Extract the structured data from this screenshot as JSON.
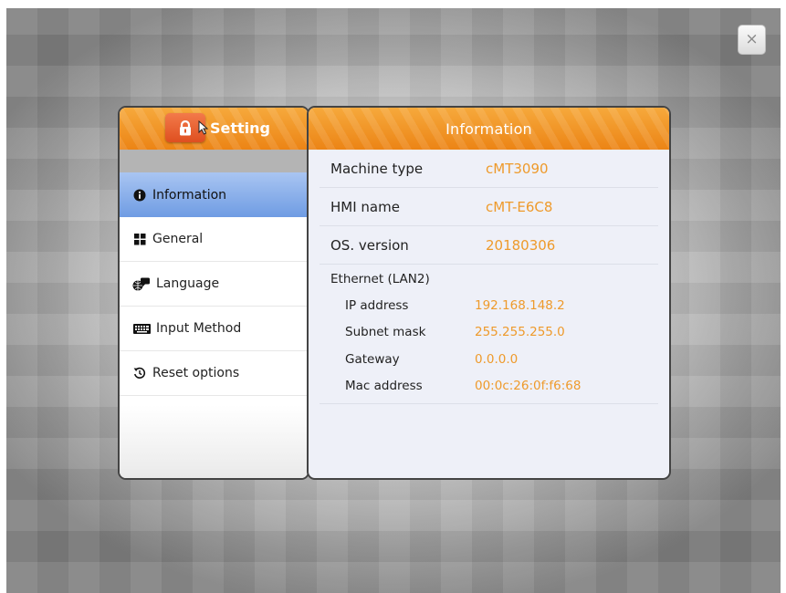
{
  "close_button": {
    "label": "×"
  },
  "left_panel": {
    "header_title": "Setting",
    "menu": [
      {
        "label": "Information",
        "icon": "info-circle-icon",
        "active": true
      },
      {
        "label": "General",
        "icon": "grid-icon",
        "active": false
      },
      {
        "label": "Language",
        "icon": "globe-chat-icon",
        "active": false
      },
      {
        "label": "Input Method",
        "icon": "keyboard-icon",
        "active": false
      },
      {
        "label": "Reset options",
        "icon": "reset-icon",
        "active": false
      }
    ]
  },
  "right_panel": {
    "header_title": "Information",
    "rows": [
      {
        "label": "Machine type",
        "value": "cMT3090"
      },
      {
        "label": "HMI name",
        "value": "cMT-E6C8"
      },
      {
        "label": "OS. version",
        "value": "20180306"
      }
    ],
    "ethernet": {
      "title": "Ethernet (LAN2)",
      "rows": [
        {
          "label": "IP address",
          "value": "192.168.148.2"
        },
        {
          "label": "Subnet mask",
          "value": "255.255.255.0"
        },
        {
          "label": "Gateway",
          "value": "0.0.0.0"
        },
        {
          "label": "Mac address",
          "value": "00:0c:26:0f:f6:68"
        }
      ]
    }
  },
  "colors": {
    "header_orange": "#ec8415",
    "value_orange": "#ee9a2b",
    "active_blue": "#6f9ce3",
    "lock_button": "#de4f20"
  }
}
